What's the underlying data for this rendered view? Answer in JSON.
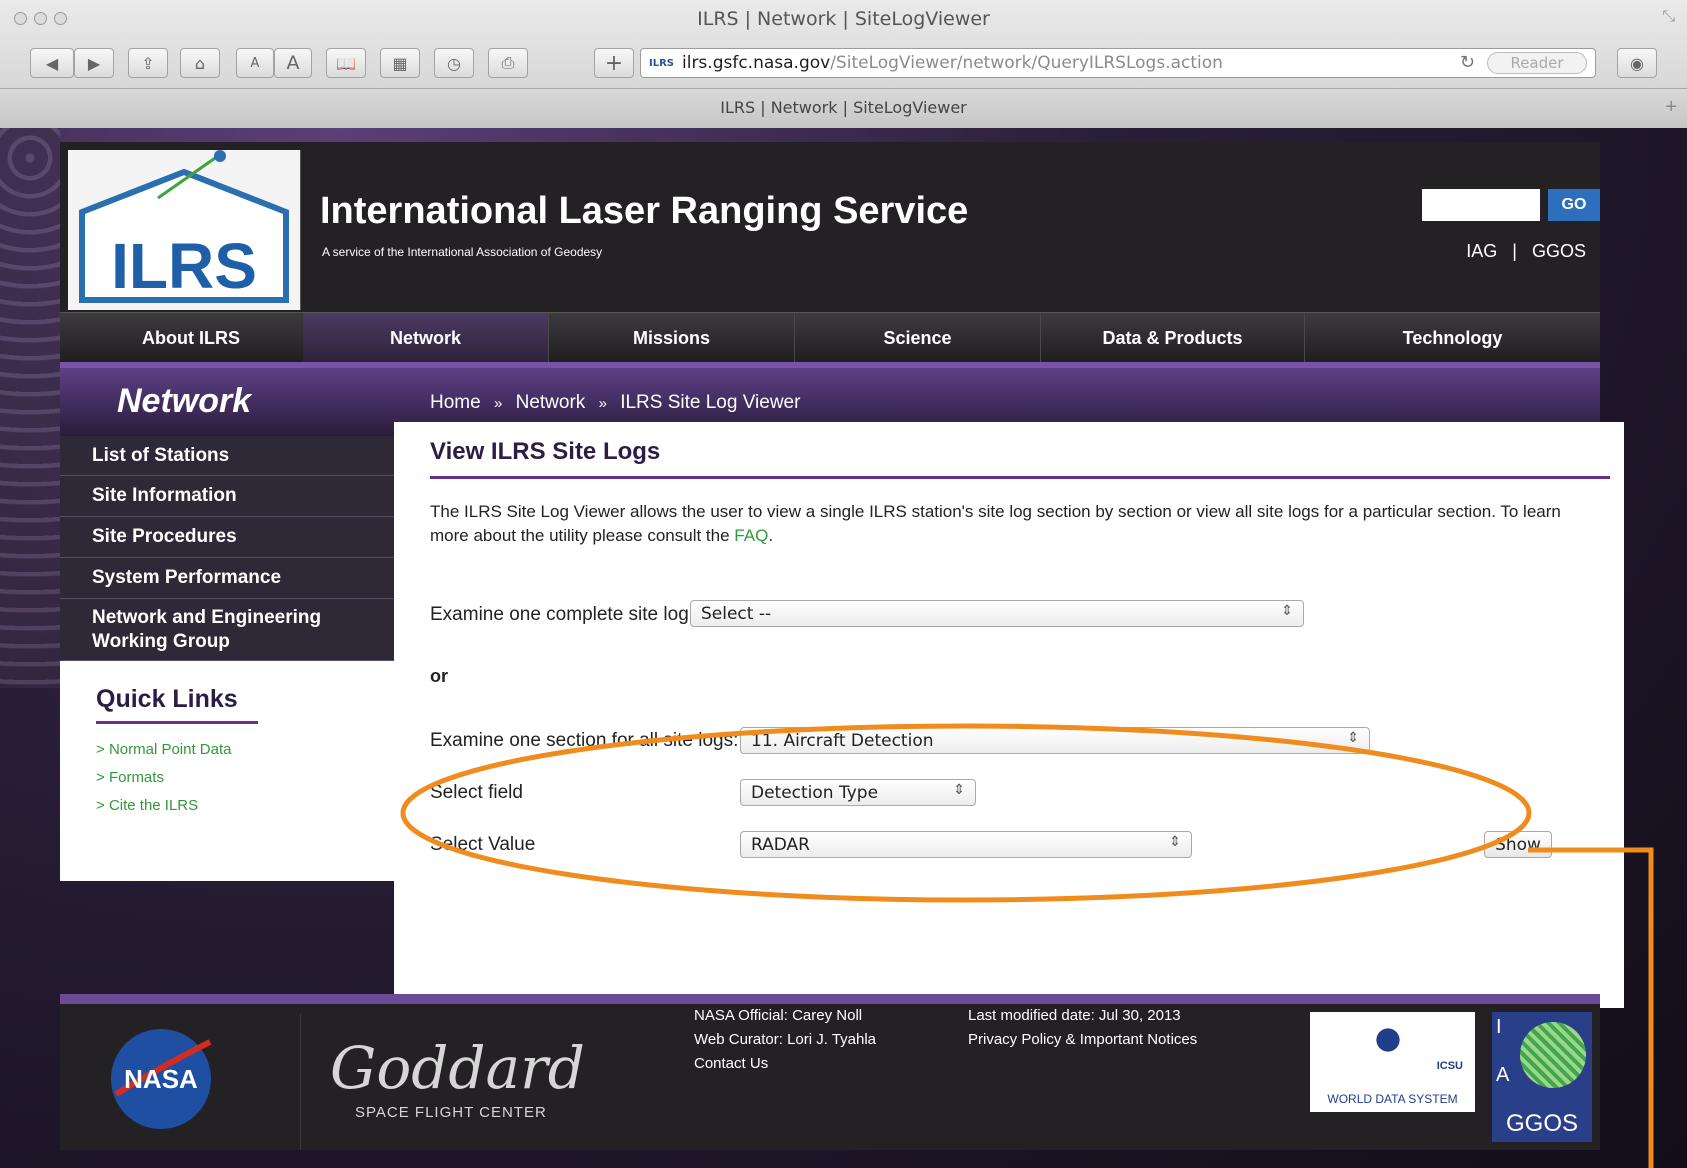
{
  "browser": {
    "window_title": "ILRS | Network | SiteLogViewer",
    "address_host": "ilrs.gsfc.nasa.gov",
    "address_path": "/SiteLogViewer/network/QueryILRSLogs.action",
    "favicon_text": "ILRS",
    "reader_label": "Reader",
    "tab_title": "ILRS | Network | SiteLogViewer",
    "toolbar": {
      "back": "◀",
      "forward": "▶",
      "share": "⇪",
      "home": "⌂",
      "font_small": "A",
      "font_large": "A",
      "bookmarks": "📖",
      "history": "◷",
      "print": "⎙",
      "add": "+",
      "reload": "↻",
      "new_tab": "+",
      "resize": "⤡"
    }
  },
  "header": {
    "logo_text": "ILRS",
    "title": "International Laser Ranging Service",
    "subtitle": "A service of the International Association of Geodesy",
    "search_placeholder": "",
    "search_button": "GO",
    "links": [
      "IAG",
      "GGOS"
    ],
    "link_separator": "|"
  },
  "nav": {
    "items": [
      "About ILRS",
      "Network",
      "Missions",
      "Science",
      "Data & Products",
      "Technology"
    ],
    "active_index": 1
  },
  "band": {
    "section_title": "Network",
    "breadcrumb": [
      "Home",
      "Network",
      "ILRS Site Log Viewer"
    ],
    "breadcrumb_sep": "»"
  },
  "sidebar": {
    "items": [
      "List of Stations",
      "Site Information",
      "Site Procedures",
      "System Performance",
      "Network and Engineering Working Group"
    ]
  },
  "quick_links": {
    "title": "Quick Links",
    "items": [
      "Normal Point Data",
      "Formats",
      "Cite the ILRS"
    ],
    "bullet": ">"
  },
  "content": {
    "title": "View ILRS Site Logs",
    "intro_text": "The ILRS Site Log Viewer allows the user to view a single ILRS station's site log section by section or view all site logs for a particular section. To learn more about the utility please consult the ",
    "intro_link": "FAQ",
    "intro_end": ".",
    "examine_complete_label": "Examine one complete site log:",
    "examine_complete_value": "Select --",
    "or_label": "or",
    "examine_section_label": "Examine one section for all site logs:",
    "examine_section_value": "11. Aircraft Detection",
    "select_field_label": "Select field",
    "select_field_value": "Detection Type",
    "select_value_label": "Select Value",
    "select_value_value": "RADAR",
    "show_button": "Show"
  },
  "footer": {
    "nasa_text": "NASA",
    "goddard_script": "Goddard",
    "goddard_sub": "SPACE FLIGHT CENTER",
    "col1": [
      "NASA Official: Carey Noll",
      "Web Curator: Lori J. Tyahla",
      "Contact Us"
    ],
    "col2": [
      "Last modified date: Jul 30, 2013",
      "Privacy Policy & Important Notices"
    ],
    "wds_text": "WORLD DATA SYSTEM",
    "icsu_text": "ICSU",
    "ggos_text": "GGOS",
    "ggos_letters": [
      "I",
      "A"
    ]
  },
  "annotation": {
    "color": "#f08c1e"
  }
}
